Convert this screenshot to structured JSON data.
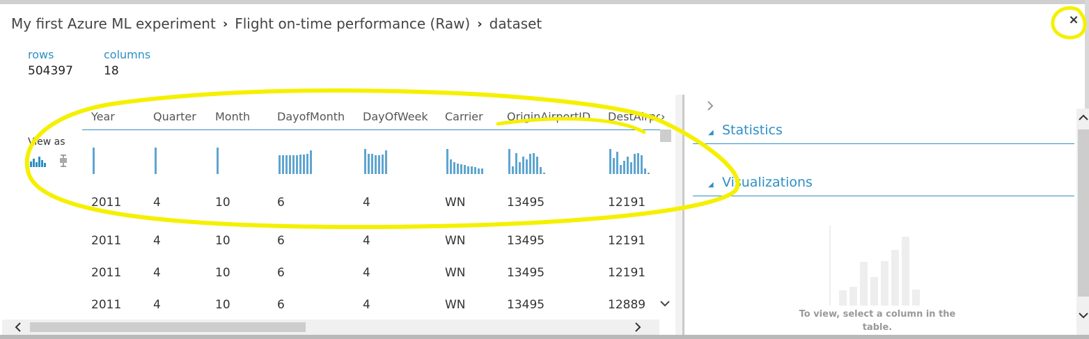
{
  "breadcrumb": [
    "My first Azure ML experiment",
    "Flight on-time performance (Raw)",
    "dataset"
  ],
  "breadcrumb_separator": "›",
  "close_label": "×",
  "stats": {
    "rows_label": "rows",
    "rows_value": "504397",
    "columns_label": "columns",
    "columns_value": "18"
  },
  "view_as_label": "View as",
  "columns": [
    "Year",
    "Quarter",
    "Month",
    "DayofMonth",
    "DayOfWeek",
    "Carrier",
    "OriginAirportID",
    "DestAirpo"
  ],
  "header_arrow": "›",
  "histograms": [
    [
      1
    ],
    [
      1
    ],
    [
      1
    ],
    [
      0.7,
      0.7,
      0.7,
      0.72,
      0.72,
      0.72,
      0.73,
      0.74,
      0.75,
      0.9
    ],
    [
      0.95,
      0.75,
      0.75,
      0.72,
      0.72,
      0.74,
      0.9
    ],
    [
      0.95,
      0.55,
      0.45,
      0.4,
      0.36,
      0.33,
      0.3,
      0.28,
      0.25,
      0.22,
      0.2
    ],
    [
      0.95,
      0.3,
      0.8,
      0.45,
      0.65,
      0.55,
      0.75,
      0.8,
      0.65,
      0.25,
      0.05
    ],
    [
      0.95,
      0.6,
      0.85,
      0.35,
      0.5,
      0.65,
      0.45,
      0.75,
      0.8,
      0.7,
      0.2,
      0.05
    ]
  ],
  "rows": [
    [
      "2011",
      "4",
      "10",
      "6",
      "4",
      "WN",
      "13495",
      "12191"
    ],
    [
      "2011",
      "4",
      "10",
      "6",
      "4",
      "WN",
      "13495",
      "12191"
    ],
    [
      "2011",
      "4",
      "10",
      "6",
      "4",
      "WN",
      "13495",
      "12191"
    ],
    [
      "2011",
      "4",
      "10",
      "6",
      "4",
      "WN",
      "13495",
      "12889"
    ]
  ],
  "right_panel": {
    "statistics": "Statistics",
    "visualizations": "Visualizations",
    "empty_message": "To view, select a column in the table."
  },
  "scroll_arrows": {
    "left": "<",
    "right": ">",
    "up": "^",
    "down": "v"
  },
  "colors": {
    "accent": "#2d8fc4",
    "histogram": "#5ea5d0",
    "annotation": "#f5f000"
  }
}
